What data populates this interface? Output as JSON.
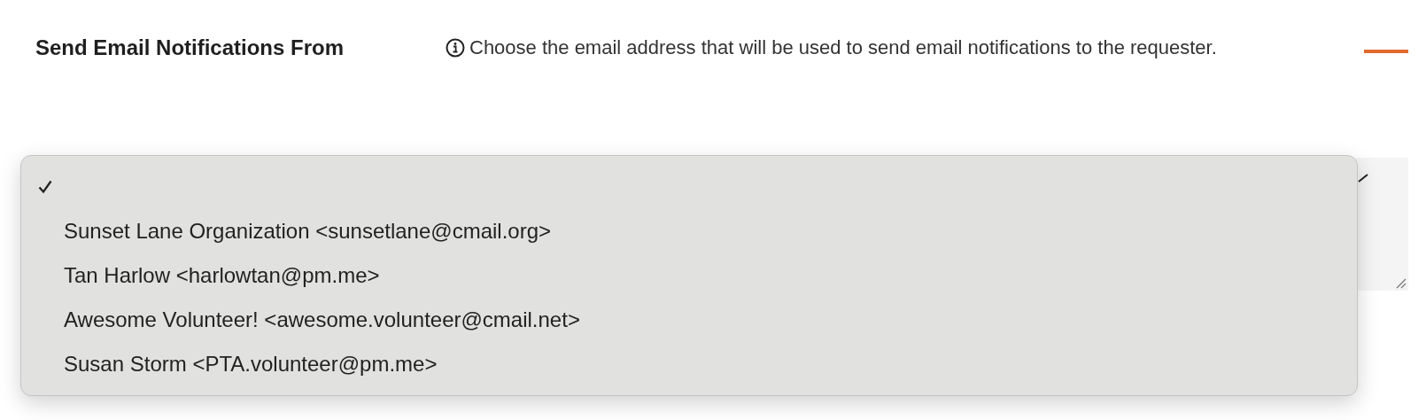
{
  "setting": {
    "label": "Send Email Notifications From",
    "help": "Choose the email address that will be used to send email notifications to the requester."
  },
  "menu": {
    "options": [
      {
        "selected": true
      },
      {
        "label": "Sunset Lane Organization <sunsetlane@cmail.org>",
        "selected": false
      },
      {
        "label": "Tan Harlow <harlowtan@pm.me>",
        "selected": false
      },
      {
        "label": "Awesome Volunteer! <awesome.volunteer@cmail.net>",
        "selected": false
      },
      {
        "label": "Susan Storm <PTA.volunteer@pm.me>",
        "selected": false
      }
    ]
  }
}
